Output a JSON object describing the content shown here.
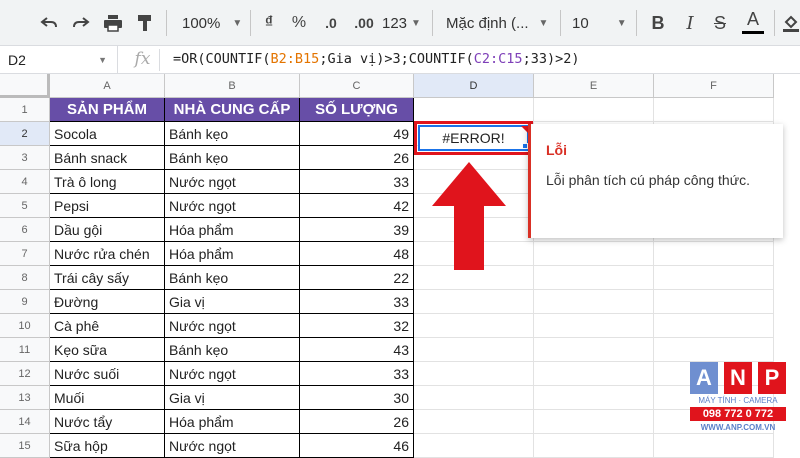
{
  "toolbar": {
    "zoom": "100%",
    "currency_symbol": "₫",
    "percent_symbol": "%",
    "decrease_decimal": ".0",
    "increase_decimal": ".00",
    "more_formats": "123",
    "font_name": "Mặc định (...",
    "font_size": "10",
    "bold": "B",
    "italic": "I",
    "strikethrough": "S",
    "text_color": "A"
  },
  "formula_bar": {
    "cell_ref": "D2",
    "fx_label": "fx",
    "formula_prefix": "=OR(COUNTIF(",
    "range1": "B2:B15",
    "sep1": ";",
    "criteria1": "Gia vị",
    "mid": ")>3;COUNTIF(",
    "range2": "C2:C15",
    "sep2": ";33)>2)"
  },
  "columns": [
    "A",
    "B",
    "C",
    "D",
    "E",
    "F"
  ],
  "rows": [
    "1",
    "2",
    "3",
    "4",
    "5",
    "6",
    "7",
    "8",
    "9",
    "10",
    "11",
    "12",
    "13",
    "14",
    "15"
  ],
  "headers": [
    "SẢN PHẨM",
    "NHÀ CUNG CẤP",
    "SỐ LƯỢNG"
  ],
  "data": [
    [
      "Socola",
      "Bánh kẹo",
      "49"
    ],
    [
      "Bánh snack",
      "Bánh kẹo",
      "26"
    ],
    [
      "Trà ô long",
      "Nước ngọt",
      "33"
    ],
    [
      "Pepsi",
      "Nước ngọt",
      "42"
    ],
    [
      "Dầu gội",
      "Hóa phẩm",
      "39"
    ],
    [
      "Nước rửa chén",
      "Hóa phẩm",
      "48"
    ],
    [
      "Trái cây sấy",
      "Bánh kẹo",
      "22"
    ],
    [
      "Đường",
      "Gia vị",
      "33"
    ],
    [
      "Cà phê",
      "Nước ngọt",
      "32"
    ],
    [
      "Kẹo sữa",
      "Bánh kẹo",
      "43"
    ],
    [
      "Nước suối",
      "Nước ngọt",
      "33"
    ],
    [
      "Muối",
      "Gia vị",
      "30"
    ],
    [
      "Nước tẩy",
      "Hóa phẩm",
      "26"
    ],
    [
      "Sữa hộp",
      "Nước ngọt",
      "46"
    ]
  ],
  "active_cell_value": "#ERROR!",
  "tooltip": {
    "title": "Lỗi",
    "body": "Lỗi phân tích cú pháp công thức."
  },
  "logo": {
    "letters": [
      "A",
      "N",
      "P"
    ],
    "tagline": "MÁY TÍNH · CAMERA",
    "phone": "098 772 0 772",
    "website": "WWW.ANP.COM.VN"
  },
  "colors": {
    "header_fill": "#674ea7",
    "error_red": "#e0141c",
    "selection_blue": "#1a73e8",
    "range1_color": "#e37400",
    "range2_color": "#7e3fb8"
  }
}
